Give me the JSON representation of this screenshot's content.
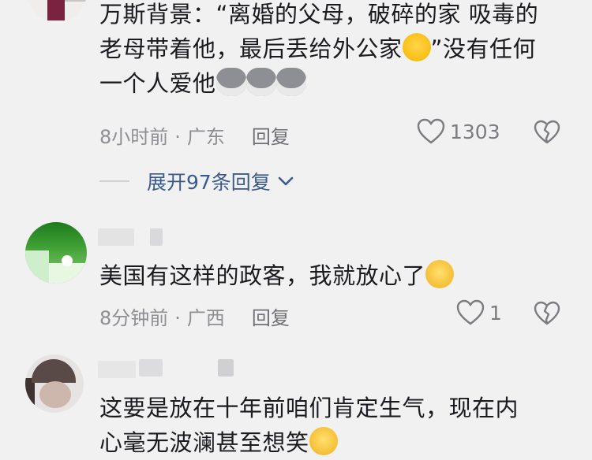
{
  "comments": [
    {
      "author_visible": "",
      "text_line1": "万斯背景：“离婚的父母，破碎的家 吸毒的",
      "text_line2_a": "老母带着他，最后丢给外公家",
      "text_line2_b": "”没有任何",
      "text_line3": "一个人爱他",
      "time": "8小时前",
      "dot": "·",
      "location": "广东",
      "reply": "回复",
      "likes": "1303",
      "expand": "展开97条回复"
    },
    {
      "text": "美国有这样的政客，我就放心了",
      "time": "8分钟前",
      "dot": "·",
      "location": "广西",
      "reply": "回复",
      "likes": "1"
    },
    {
      "text_line1": "这要是放在十年前咱们肯定生气，现在内",
      "text_line2": "心毫无波澜甚至想笑"
    }
  ],
  "icons": {
    "like": "heart-outline-icon",
    "dislike": "broken-heart-icon",
    "expand": "chevron-down-icon"
  },
  "colors": {
    "background": "#f1f1f2",
    "text": "#1b1b1f",
    "meta": "#8e8e93",
    "link": "#3a5a8c"
  }
}
